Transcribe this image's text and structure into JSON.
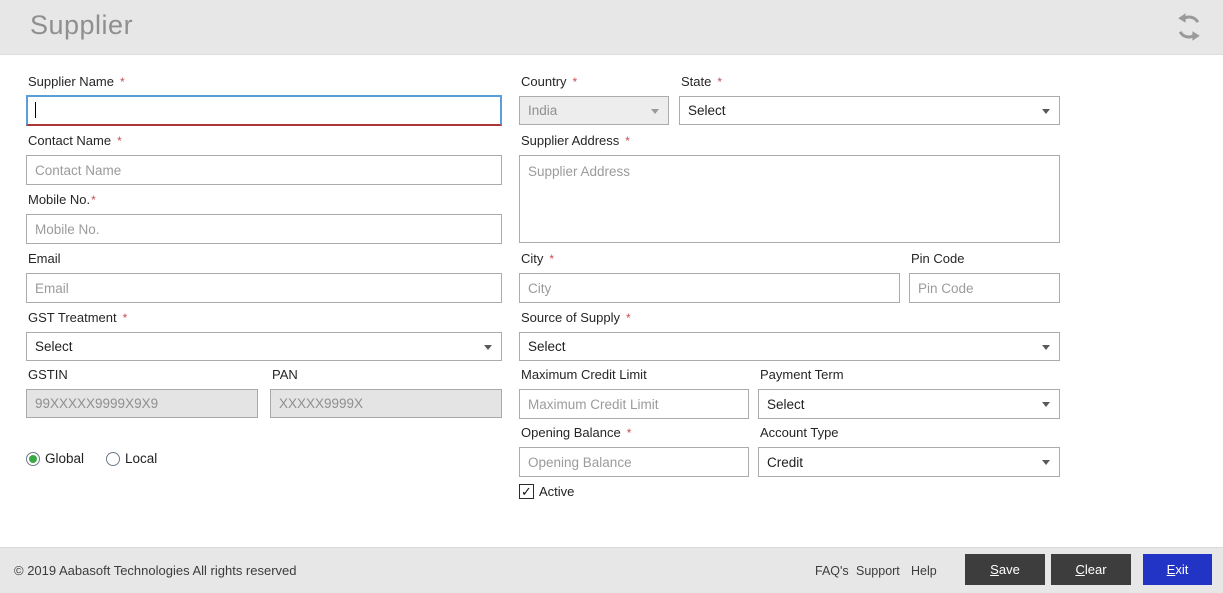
{
  "header": {
    "title": "Supplier",
    "refresh_icon": "refresh-sync"
  },
  "form": {
    "required_marker": "*",
    "supplier_name": {
      "label": "Supplier Name",
      "value": ""
    },
    "contact_name": {
      "label": "Contact Name",
      "placeholder": "Contact Name"
    },
    "mobile_no": {
      "label": "Mobile No.",
      "placeholder": "Mobile No."
    },
    "email": {
      "label": "Email",
      "placeholder": "Email"
    },
    "gst_treatment": {
      "label": "GST Treatment",
      "value": "Select"
    },
    "gstin": {
      "label": "GSTIN",
      "placeholder": "99XXXXX9999X9X9"
    },
    "pan": {
      "label": "PAN",
      "placeholder": "XXXXX9999X"
    },
    "scope": {
      "options": [
        "Global",
        "Local"
      ],
      "selected": "Global"
    },
    "country": {
      "label": "Country",
      "value": "India"
    },
    "state": {
      "label": "State",
      "value": "Select"
    },
    "supplier_address": {
      "label": "Supplier Address",
      "placeholder": "Supplier Address"
    },
    "city": {
      "label": "City",
      "placeholder": "City"
    },
    "pin_code": {
      "label": "Pin Code",
      "placeholder": "Pin Code"
    },
    "source_of_supply": {
      "label": "Source of Supply",
      "value": "Select"
    },
    "maximum_credit_limit": {
      "label": "Maximum Credit Limit",
      "placeholder": "Maximum Credit Limit"
    },
    "payment_term": {
      "label": "Payment Term",
      "value": "Select"
    },
    "opening_balance": {
      "label": "Opening Balance",
      "placeholder": "Opening Balance"
    },
    "account_type": {
      "label": "Account Type",
      "value": "Credit"
    },
    "active": {
      "label": "Active",
      "checked": true,
      "check_glyph": "✓"
    }
  },
  "footer": {
    "copyright": "© 2019 Aabasoft Technologies All rights reserved",
    "links": [
      "FAQ's",
      "Support",
      "Help"
    ],
    "buttons": {
      "save": "Save",
      "clear": "Clear",
      "exit": "Exit"
    }
  },
  "colors": {
    "focus_border_blue": "#5b9fd8",
    "focus_border_red": "#ab3537",
    "exit_button_blue": "#2134c6",
    "radio_selected_green": "#3aa945",
    "header_gray": "#e7e7e7"
  }
}
